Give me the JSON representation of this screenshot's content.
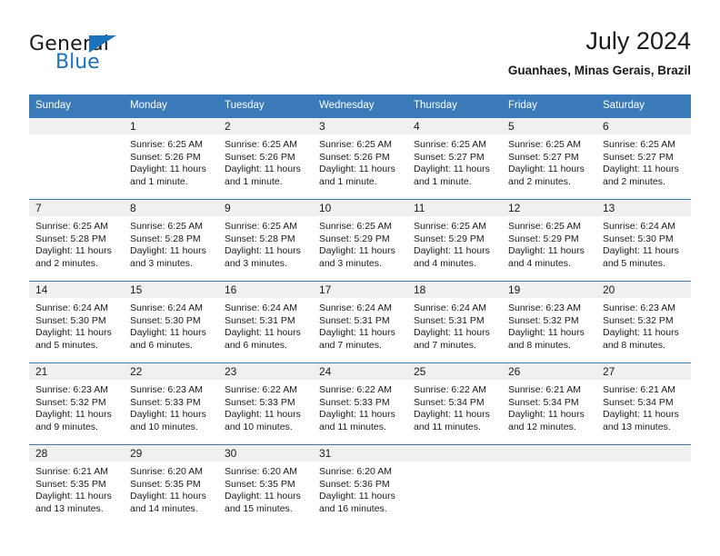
{
  "logo": {
    "text_primary": "General",
    "text_secondary": "Blue",
    "color_primary": "#1a1a1a",
    "color_secondary": "#1c72bb"
  },
  "header": {
    "title": "July 2024",
    "subtitle": "Guanhaes, Minas Gerais, Brazil"
  },
  "colors": {
    "header_band": "#3a7ab8",
    "daynum_band": "#f0f0f0",
    "text": "#1a1a1a"
  },
  "weekdays": [
    "Sunday",
    "Monday",
    "Tuesday",
    "Wednesday",
    "Thursday",
    "Friday",
    "Saturday"
  ],
  "weeks": [
    [
      {
        "day": "",
        "sunrise": "",
        "sunset": "",
        "daylight": ""
      },
      {
        "day": "1",
        "sunrise": "Sunrise: 6:25 AM",
        "sunset": "Sunset: 5:26 PM",
        "daylight": "Daylight: 11 hours and 1 minute."
      },
      {
        "day": "2",
        "sunrise": "Sunrise: 6:25 AM",
        "sunset": "Sunset: 5:26 PM",
        "daylight": "Daylight: 11 hours and 1 minute."
      },
      {
        "day": "3",
        "sunrise": "Sunrise: 6:25 AM",
        "sunset": "Sunset: 5:26 PM",
        "daylight": "Daylight: 11 hours and 1 minute."
      },
      {
        "day": "4",
        "sunrise": "Sunrise: 6:25 AM",
        "sunset": "Sunset: 5:27 PM",
        "daylight": "Daylight: 11 hours and 1 minute."
      },
      {
        "day": "5",
        "sunrise": "Sunrise: 6:25 AM",
        "sunset": "Sunset: 5:27 PM",
        "daylight": "Daylight: 11 hours and 2 minutes."
      },
      {
        "day": "6",
        "sunrise": "Sunrise: 6:25 AM",
        "sunset": "Sunset: 5:27 PM",
        "daylight": "Daylight: 11 hours and 2 minutes."
      }
    ],
    [
      {
        "day": "7",
        "sunrise": "Sunrise: 6:25 AM",
        "sunset": "Sunset: 5:28 PM",
        "daylight": "Daylight: 11 hours and 2 minutes."
      },
      {
        "day": "8",
        "sunrise": "Sunrise: 6:25 AM",
        "sunset": "Sunset: 5:28 PM",
        "daylight": "Daylight: 11 hours and 3 minutes."
      },
      {
        "day": "9",
        "sunrise": "Sunrise: 6:25 AM",
        "sunset": "Sunset: 5:28 PM",
        "daylight": "Daylight: 11 hours and 3 minutes."
      },
      {
        "day": "10",
        "sunrise": "Sunrise: 6:25 AM",
        "sunset": "Sunset: 5:29 PM",
        "daylight": "Daylight: 11 hours and 3 minutes."
      },
      {
        "day": "11",
        "sunrise": "Sunrise: 6:25 AM",
        "sunset": "Sunset: 5:29 PM",
        "daylight": "Daylight: 11 hours and 4 minutes."
      },
      {
        "day": "12",
        "sunrise": "Sunrise: 6:25 AM",
        "sunset": "Sunset: 5:29 PM",
        "daylight": "Daylight: 11 hours and 4 minutes."
      },
      {
        "day": "13",
        "sunrise": "Sunrise: 6:24 AM",
        "sunset": "Sunset: 5:30 PM",
        "daylight": "Daylight: 11 hours and 5 minutes."
      }
    ],
    [
      {
        "day": "14",
        "sunrise": "Sunrise: 6:24 AM",
        "sunset": "Sunset: 5:30 PM",
        "daylight": "Daylight: 11 hours and 5 minutes."
      },
      {
        "day": "15",
        "sunrise": "Sunrise: 6:24 AM",
        "sunset": "Sunset: 5:30 PM",
        "daylight": "Daylight: 11 hours and 6 minutes."
      },
      {
        "day": "16",
        "sunrise": "Sunrise: 6:24 AM",
        "sunset": "Sunset: 5:31 PM",
        "daylight": "Daylight: 11 hours and 6 minutes."
      },
      {
        "day": "17",
        "sunrise": "Sunrise: 6:24 AM",
        "sunset": "Sunset: 5:31 PM",
        "daylight": "Daylight: 11 hours and 7 minutes."
      },
      {
        "day": "18",
        "sunrise": "Sunrise: 6:24 AM",
        "sunset": "Sunset: 5:31 PM",
        "daylight": "Daylight: 11 hours and 7 minutes."
      },
      {
        "day": "19",
        "sunrise": "Sunrise: 6:23 AM",
        "sunset": "Sunset: 5:32 PM",
        "daylight": "Daylight: 11 hours and 8 minutes."
      },
      {
        "day": "20",
        "sunrise": "Sunrise: 6:23 AM",
        "sunset": "Sunset: 5:32 PM",
        "daylight": "Daylight: 11 hours and 8 minutes."
      }
    ],
    [
      {
        "day": "21",
        "sunrise": "Sunrise: 6:23 AM",
        "sunset": "Sunset: 5:32 PM",
        "daylight": "Daylight: 11 hours and 9 minutes."
      },
      {
        "day": "22",
        "sunrise": "Sunrise: 6:23 AM",
        "sunset": "Sunset: 5:33 PM",
        "daylight": "Daylight: 11 hours and 10 minutes."
      },
      {
        "day": "23",
        "sunrise": "Sunrise: 6:22 AM",
        "sunset": "Sunset: 5:33 PM",
        "daylight": "Daylight: 11 hours and 10 minutes."
      },
      {
        "day": "24",
        "sunrise": "Sunrise: 6:22 AM",
        "sunset": "Sunset: 5:33 PM",
        "daylight": "Daylight: 11 hours and 11 minutes."
      },
      {
        "day": "25",
        "sunrise": "Sunrise: 6:22 AM",
        "sunset": "Sunset: 5:34 PM",
        "daylight": "Daylight: 11 hours and 11 minutes."
      },
      {
        "day": "26",
        "sunrise": "Sunrise: 6:21 AM",
        "sunset": "Sunset: 5:34 PM",
        "daylight": "Daylight: 11 hours and 12 minutes."
      },
      {
        "day": "27",
        "sunrise": "Sunrise: 6:21 AM",
        "sunset": "Sunset: 5:34 PM",
        "daylight": "Daylight: 11 hours and 13 minutes."
      }
    ],
    [
      {
        "day": "28",
        "sunrise": "Sunrise: 6:21 AM",
        "sunset": "Sunset: 5:35 PM",
        "daylight": "Daylight: 11 hours and 13 minutes."
      },
      {
        "day": "29",
        "sunrise": "Sunrise: 6:20 AM",
        "sunset": "Sunset: 5:35 PM",
        "daylight": "Daylight: 11 hours and 14 minutes."
      },
      {
        "day": "30",
        "sunrise": "Sunrise: 6:20 AM",
        "sunset": "Sunset: 5:35 PM",
        "daylight": "Daylight: 11 hours and 15 minutes."
      },
      {
        "day": "31",
        "sunrise": "Sunrise: 6:20 AM",
        "sunset": "Sunset: 5:36 PM",
        "daylight": "Daylight: 11 hours and 16 minutes."
      },
      {
        "day": "",
        "sunrise": "",
        "sunset": "",
        "daylight": ""
      },
      {
        "day": "",
        "sunrise": "",
        "sunset": "",
        "daylight": ""
      },
      {
        "day": "",
        "sunrise": "",
        "sunset": "",
        "daylight": ""
      }
    ]
  ]
}
